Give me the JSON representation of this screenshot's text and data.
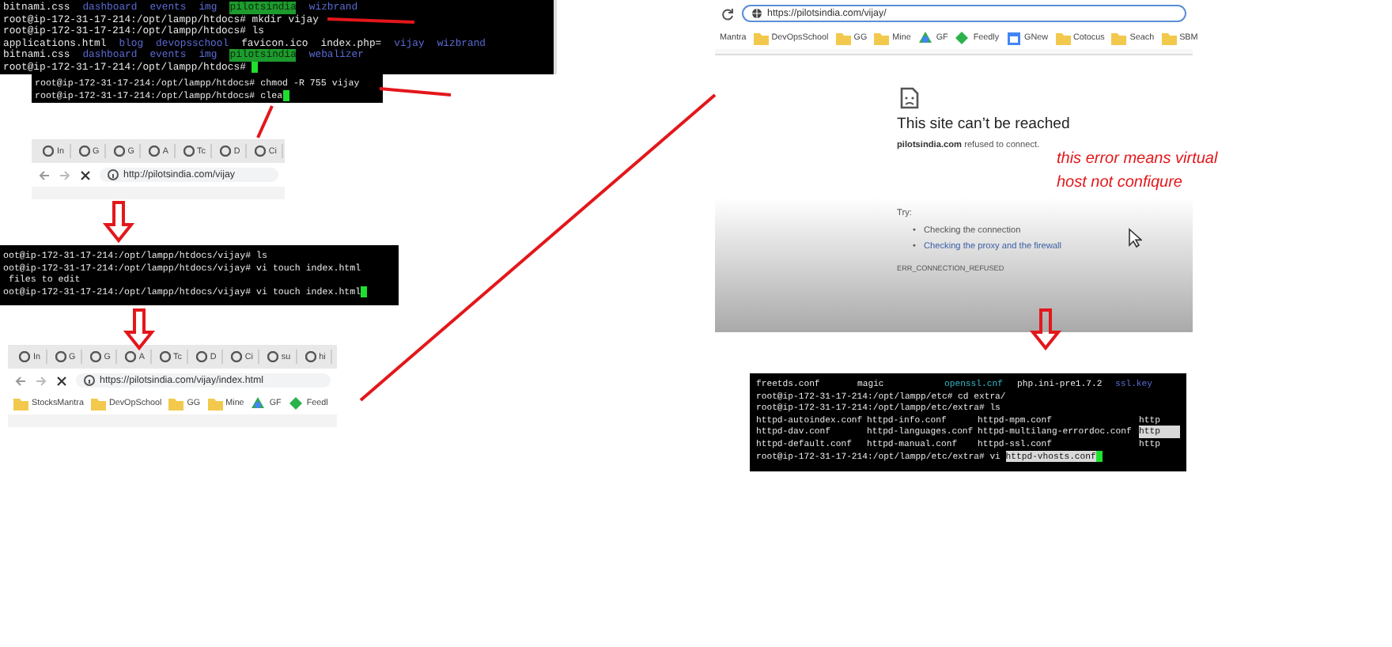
{
  "terminals": [
    {
      "lines": [
        [
          {
            "text": "bitnami.css",
            "kind": "file"
          },
          {
            "text": "dashboard",
            "kind": "dir"
          },
          {
            "text": "events",
            "kind": "dir"
          },
          {
            "text": "img",
            "kind": "dir"
          },
          {
            "text": "pilotsindia",
            "kind": "highlight"
          },
          {
            "text": "wizbrand",
            "kind": "dir"
          }
        ],
        [
          {
            "text": "root@ip-172-31-17-214:/opt/lampp/htdocs# mkdir vijay",
            "kind": "prompt"
          }
        ],
        [
          {
            "text": "root@ip-172-31-17-214:/opt/lampp/htdocs# ls",
            "kind": "prompt"
          }
        ],
        [
          {
            "text": "applications.html",
            "kind": "file"
          },
          {
            "text": "blog",
            "kind": "dir"
          },
          {
            "text": "devopsschool",
            "kind": "dir"
          },
          {
            "text": "favicon.ico",
            "kind": "file"
          },
          {
            "text": "index.php=",
            "kind": "file"
          },
          {
            "text": "vijay",
            "kind": "dir"
          },
          {
            "text": "wizbrand",
            "kind": "dir"
          }
        ],
        [
          {
            "text": "bitnami.css",
            "kind": "file"
          },
          {
            "text": "dashboard",
            "kind": "dir"
          },
          {
            "text": "events",
            "kind": "dir"
          },
          {
            "text": "img",
            "kind": "dir"
          },
          {
            "text": "pilotsindia",
            "kind": "highlight"
          },
          {
            "text": "webalizer",
            "kind": "dir"
          }
        ],
        [
          {
            "text": "root@ip-172-31-17-214:/opt/lampp/htdocs# ",
            "kind": "prompt",
            "cursor": true
          }
        ]
      ]
    },
    {
      "lines": [
        [
          {
            "text": "root@ip-172-31-17-214:/opt/lampp/htdocs# chmod -R 755 vijay",
            "kind": "prompt"
          }
        ],
        [
          {
            "text": "root@ip-172-31-17-214:/opt/lampp/htdocs# clea",
            "kind": "prompt",
            "cursor": true
          }
        ]
      ]
    },
    {
      "lines": [
        [
          {
            "text": "oot@ip-172-31-17-214:/opt/lampp/htdocs/vijay# ls",
            "kind": "prompt"
          }
        ],
        [
          {
            "text": "oot@ip-172-31-17-214:/opt/lampp/htdocs/vijay# vi touch index.html",
            "kind": "prompt"
          }
        ],
        [
          {
            "text": " files to edit",
            "kind": "prompt"
          }
        ],
        [
          {
            "text": "oot@ip-172-31-17-214:/opt/lampp/htdocs/vijay# vi touch index.html",
            "kind": "prompt",
            "cursor": true
          }
        ]
      ]
    },
    {
      "lines": [
        [
          {
            "text": "freetds.conf",
            "kind": "file"
          },
          {
            "text": "magic",
            "kind": "file"
          },
          {
            "text": "openssl.cnf",
            "kind": "link"
          },
          {
            "text": "php.ini-pre1.7.2",
            "kind": "file"
          },
          {
            "text": "ssl.key",
            "kind": "dir"
          }
        ],
        [
          {
            "text": "root@ip-172-31-17-214:/opt/lampp/etc# cd extra/",
            "kind": "prompt"
          }
        ],
        [
          {
            "text": "root@ip-172-31-17-214:/opt/lampp/etc/extra# ls",
            "kind": "prompt"
          }
        ],
        [
          {
            "text": "httpd-autoindex.conf",
            "kind": "file"
          },
          {
            "text": "httpd-info.conf",
            "kind": "file"
          },
          {
            "text": "httpd-mpm.conf",
            "kind": "file"
          },
          {
            "text": "http",
            "kind": "file"
          }
        ],
        [
          {
            "text": "httpd-dav.conf",
            "kind": "file"
          },
          {
            "text": "httpd-languages.conf",
            "kind": "file"
          },
          {
            "text": "httpd-multilang-errordoc.conf",
            "kind": "file"
          },
          {
            "text": "http",
            "kind": "selected"
          }
        ],
        [
          {
            "text": "httpd-default.conf",
            "kind": "file"
          },
          {
            "text": "httpd-manual.conf",
            "kind": "file"
          },
          {
            "text": "httpd-ssl.conf",
            "kind": "file"
          },
          {
            "text": "http",
            "kind": "file"
          }
        ],
        [
          {
            "text": "root@ip-172-31-17-214:/opt/lampp/etc/extra# vi ",
            "kind": "prompt"
          },
          {
            "text": "httpd-vhosts.conf",
            "kind": "selected",
            "cursor": true
          }
        ]
      ]
    }
  ],
  "browsers": [
    {
      "tabs": [
        "In",
        "G",
        "G",
        "A",
        "Tc",
        "D",
        "Ci"
      ],
      "address": "http://pilotsindia.com/vijay",
      "secure": false
    },
    {
      "tabs": [
        "In",
        "G",
        "G",
        "A",
        "Tc",
        "D",
        "Ci",
        "su",
        "hi"
      ],
      "address": "https://pilotsindia.com/vijay/index.html",
      "secure": false,
      "bookmarks": [
        {
          "label": "StocksMantra",
          "kind": "folder"
        },
        {
          "label": "DevOpSchool",
          "kind": "folder"
        },
        {
          "label": "GG",
          "kind": "folder"
        },
        {
          "label": "Mine",
          "kind": "folder"
        },
        {
          "label": "GF",
          "kind": "app"
        },
        {
          "label": "Feedl",
          "kind": "site"
        }
      ]
    },
    {
      "address": "https://pilotsindia.com/vijay/",
      "secure": true,
      "bookmarks": [
        {
          "label": "Mantra",
          "kind": "plain"
        },
        {
          "label": "DevOpsSchool",
          "kind": "folder"
        },
        {
          "label": "GG",
          "kind": "folder"
        },
        {
          "label": "Mine",
          "kind": "folder"
        },
        {
          "label": "GF",
          "kind": "app"
        },
        {
          "label": "Feedly",
          "kind": "site"
        },
        {
          "label": "GNew",
          "kind": "calendar"
        },
        {
          "label": "Cotocus",
          "kind": "folder"
        },
        {
          "label": "Seach",
          "kind": "folder"
        },
        {
          "label": "SBM",
          "kind": "folder"
        }
      ]
    }
  ],
  "error_page": {
    "title": "This site can’t be reached",
    "message": "**pilotsindia.com** refused to connect.",
    "try_label": "Try:",
    "suggestions": [
      {
        "marker": "•",
        "text": "Checking the connection",
        "kind": "plain"
      },
      {
        "marker": "•",
        "text": "Checking the proxy and the firewall",
        "kind": "link"
      }
    ],
    "code": "ERR_CONNECTION_REFUSED"
  },
  "annotation": [
    "this error means virtual",
    "host not confiqure"
  ]
}
